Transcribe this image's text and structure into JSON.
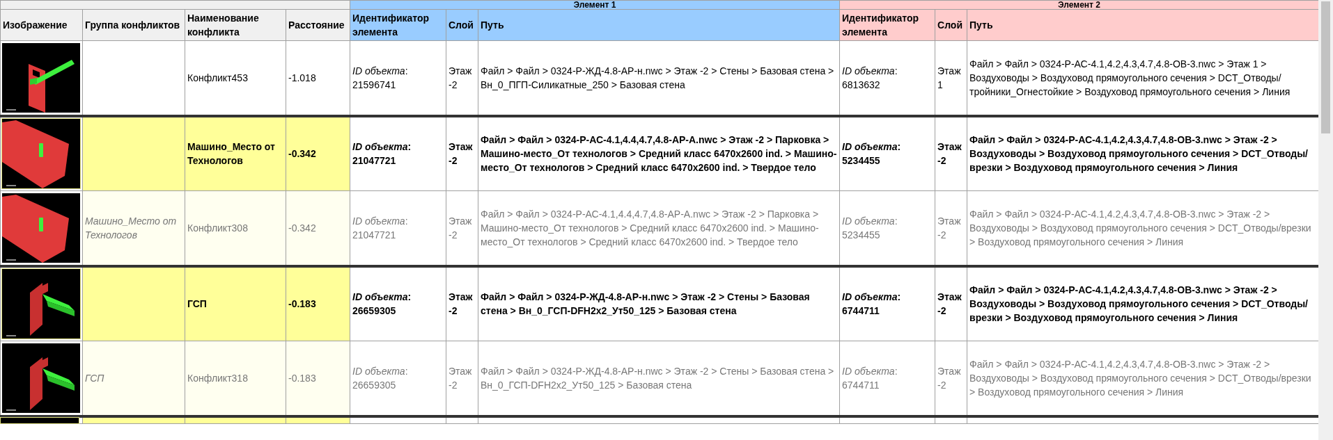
{
  "group_headers": [
    {
      "label": "Элемент 1",
      "kind": "e1"
    },
    {
      "label": "Элемент 2",
      "kind": "e2"
    }
  ],
  "columns": [
    {
      "label": "Изображение",
      "kind": "main"
    },
    {
      "label": "Группа конфликтов",
      "kind": "main"
    },
    {
      "label": "Наименование конфликта",
      "kind": "main"
    },
    {
      "label": "Расстояние",
      "kind": "main"
    },
    {
      "label": "Идентификатор элемента",
      "kind": "e1"
    },
    {
      "label": "Слой",
      "kind": "e1"
    },
    {
      "label": "Путь",
      "kind": "e1"
    },
    {
      "label": "Идентификатор элемента",
      "kind": "e2"
    },
    {
      "label": "Слой",
      "kind": "e2"
    },
    {
      "label": "Путь",
      "kind": "e2"
    }
  ],
  "rows": [
    {
      "kind": "single",
      "image": {
        "kind": "wall-duct"
      },
      "name": "Конфликт453",
      "distance": "-1.018",
      "e1_id": "*ID объекта*: 21596741",
      "e1_layer": "Этаж -2",
      "e1_path": "Файл > Файл > 0324-Р-ЖД-4.8-АР-н.nwc > Этаж -2 > Стены > Базовая стена > Вн_0_ПГП-Силикатные_250 > Базовая стена",
      "e2_id": "*ID объекта*: 6813632",
      "e2_layer": "Этаж 1",
      "e2_path": "Файл > Файл > 0324-Р-АС-4.1,4.2,4.3,4.7,4.8-ОВ-3.nwc > Этаж 1 > Воздуховоды > Воздуховод прямоугольного сечения > DCT_Отводы/тройники_Огнестойкие > Воздуховод прямоугольного сечения > Линия"
    },
    {
      "kind": "group",
      "image": {
        "kind": "parking"
      },
      "name": "Машино_Место от Технологов",
      "distance": "-0.342",
      "e1_id": "*ID объекта*: 21047721",
      "e1_layer": "Этаж -2",
      "e1_path": "Файл > Файл > 0324-Р-АС-4.1,4.4,4.7,4.8-АР-А.nwc > Этаж -2 > Парковка > Машино-место_От технологов > Средний класс 6470x2600 ind. > Машино-место_От технологов > Средний класс 6470x2600 ind. > Твердое тело",
      "e2_id": "*ID объекта*: 5234455",
      "e2_layer": "Этаж -2",
      "e2_path": "Файл > Файл > 0324-Р-АС-4.1,4.2,4.3,4.7,4.8-ОВ-3.nwc > Этаж -2 > Воздуховоды > Воздуховод прямоугольного сечения > DCT_Отводы/врезки > Воздуховод прямоугольного сечения > Линия"
    },
    {
      "kind": "item",
      "image": {
        "kind": "parking"
      },
      "group": "Машино_Место от Технологов",
      "name": "Конфликт308",
      "distance": "-0.342",
      "e1_id": "*ID объекта*: 21047721",
      "e1_layer": "Этаж -2",
      "e1_path": "Файл > Файл > 0324-Р-АС-4.1,4.4,4.7,4.8-АР-А.nwc > Этаж -2 > Парковка > Машино-место_От технологов > Средний класс 6470x2600 ind. > Машино-место_От технологов > Средний класс 6470x2600 ind. > Твердое тело",
      "e2_id": "*ID объекта*: 5234455",
      "e2_layer": "Этаж -2",
      "e2_path": "Файл > Файл > 0324-Р-АС-4.1,4.2,4.3,4.7,4.8-ОВ-3.nwc > Этаж -2 > Воздуховоды > Воздуховод прямоугольного сечения > DCT_Отводы/врезки > Воздуховод прямоугольного сечения > Линия"
    },
    {
      "kind": "group",
      "image": {
        "kind": "wall-duct-wide"
      },
      "name": "ГСП",
      "distance": "-0.183",
      "e1_id": "*ID объекта*: 26659305",
      "e1_layer": "Этаж -2",
      "e1_path": "Файл > Файл > 0324-Р-ЖД-4.8-АР-н.nwc > Этаж -2 > Стены > Базовая стена > Вн_0_ГСП-DFH2x2_Ут50_125 > Базовая стена",
      "e2_id": "*ID объекта*: 6744711",
      "e2_layer": "Этаж -2",
      "e2_path": "Файл > Файл > 0324-Р-АС-4.1,4.2,4.3,4.7,4.8-ОВ-3.nwc > Этаж -2 > Воздуховоды > Воздуховод прямоугольного сечения > DCT_Отводы/врезки > Воздуховод прямоугольного сечения > Линия"
    },
    {
      "kind": "item",
      "image": {
        "kind": "wall-duct-wide"
      },
      "group": "ГСП",
      "name": "Конфликт318",
      "distance": "-0.183",
      "e1_id": "*ID объекта*: 26659305",
      "e1_layer": "Этаж -2",
      "e1_path": "Файл > Файл > 0324-Р-ЖД-4.8-АР-н.nwc > Этаж -2 > Стены > Базовая стена > Вн_0_ГСП-DFH2x2_Ут50_125 > Базовая стена",
      "e2_id": "*ID объекта*: 6744711",
      "e2_layer": "Этаж -2",
      "e2_path": "Файл > Файл > 0324-Р-АС-4.1,4.2,4.3,4.7,4.8-ОВ-3.nwc > Этаж -2 > Воздуховоды > Воздуховод прямоугольного сечения > DCT_Отводы/врезки > Воздуховод прямоугольного сечения > Линия"
    },
    {
      "kind": "group"
    }
  ]
}
